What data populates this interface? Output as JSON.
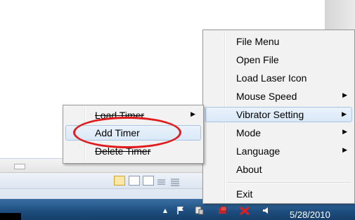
{
  "main_menu": {
    "items": [
      {
        "label": "File Menu",
        "submenu": false
      },
      {
        "label": "Open File",
        "submenu": false
      },
      {
        "label": "Load Laser Icon",
        "submenu": false
      },
      {
        "label": "Mouse Speed",
        "submenu": true
      },
      {
        "label": "Vibrator Setting",
        "submenu": true,
        "highlighted": true
      },
      {
        "label": "Mode",
        "submenu": true
      },
      {
        "label": "Language",
        "submenu": true
      },
      {
        "label": "About",
        "submenu": false
      },
      {
        "label": "Exit",
        "submenu": false
      }
    ],
    "arrow_glyph": "▶"
  },
  "sub_menu": {
    "items": [
      {
        "label": "Load Timer",
        "submenu": true,
        "struck": true
      },
      {
        "label": "Add Timer",
        "submenu": false,
        "highlighted": true,
        "circled": true
      },
      {
        "label": "Delete Timer",
        "submenu": false,
        "struck": true
      }
    ],
    "arrow_glyph": "▶"
  },
  "taskbar": {
    "clock_date": "5/28/2010",
    "tray_icons": [
      "show-hidden-icons-icon",
      "flag-icon",
      "device-icon",
      "network-icon",
      "warning-x-icon",
      "volume-icon"
    ]
  },
  "colors": {
    "menu_background": "#f2f2f2",
    "highlight_border": "#a9c5e6",
    "annotation_red": "#e01b1b",
    "taskbar_blue": "#1d4d7e"
  }
}
